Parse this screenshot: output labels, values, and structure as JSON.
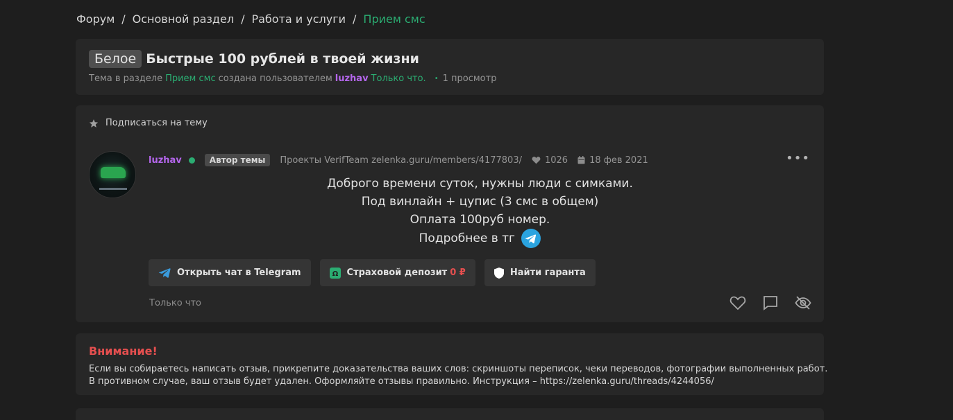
{
  "breadcrumb": [
    "Форум",
    "Основной раздел",
    "Работа и услуги",
    "Прием смс"
  ],
  "thread": {
    "prefix": "Белое",
    "title": "Быстрые 100 рублей в твоей жизни",
    "meta_prefix": "Тема в разделе",
    "meta_section": "Прием смс",
    "meta_created_by": "создана пользователем",
    "meta_author": "luzhav",
    "meta_time": "Только что.",
    "meta_views": "1 просмотр"
  },
  "subscribe_label": "Подписаться на тему",
  "post": {
    "username": "luzhav",
    "badge": "Автор темы",
    "projects": "Проекты VerifTeam zelenka.guru/members/4177803/",
    "likes": "1026",
    "date": "18 фев 2021",
    "lines": [
      "Доброго времени суток, нужны люди с симками.",
      "Под винлайн + цупис (3 смс в общем)",
      "Оплата 100руб номер.",
      "Подробнее в тг"
    ],
    "btn_telegram": "Открыть чат в Telegram",
    "btn_deposit": "Страховой депозит",
    "btn_deposit_amount": "0 ₽",
    "btn_guarantor": "Найти гаранта",
    "time_ago": "Только что"
  },
  "warning": {
    "title": "Внимание!",
    "line1": "Если вы собираетесь написать отзыв, прикрепите доказательства ваших слов: скриншоты переписок, чеки переводов, фотографии выполненных работ.",
    "line2": "В противном случае, ваш отзыв будет удален. Оформляйте отзывы правильно. Инструкция – https://zelenka.guru/threads/4244056/"
  },
  "colors": {
    "accent_green": "#2bad72",
    "username_purple": "#b466ec",
    "warning_red": "#e54f4f",
    "background": "#1e1e1e",
    "card": "#272727"
  }
}
